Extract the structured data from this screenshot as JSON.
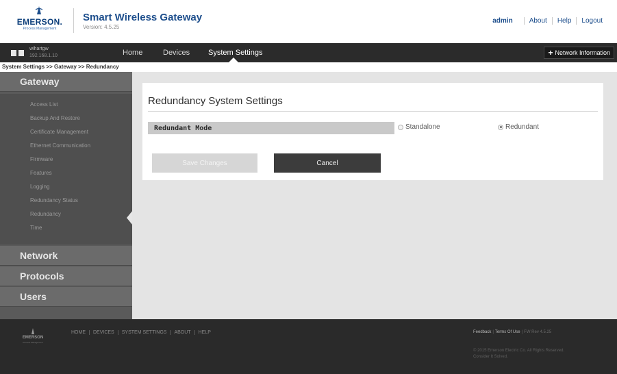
{
  "colors": {
    "brand_blue": "#1d4e8c",
    "nav_bg": "#2b2b2b",
    "sidebar_bg": "#4f4f4f",
    "sidebar_head_bg": "#6b6b6b",
    "main_bg": "#e4e4e4",
    "footer_bg": "#2a2a2a",
    "cancel_bg": "#3c3c3c",
    "save_disabled_bg": "#d6d6d6"
  },
  "header": {
    "logo_text": "EMERSON.",
    "logo_subtext": "Process Management",
    "app_title": "Smart Wireless Gateway",
    "version": "Version: 4.5.25",
    "user": "admin",
    "links": [
      "About",
      "Help",
      "Logout"
    ]
  },
  "navbar": {
    "gateway_name": "wihartgw",
    "gateway_ip": "192.168.1.10",
    "items": [
      "Home",
      "Devices",
      "System Settings"
    ],
    "active_item": "System Settings",
    "network_info_label": "Network Information",
    "network_info_icon": "plus-icon"
  },
  "breadcrumb": "System Settings >> Gateway >> Redundancy",
  "sidebar": {
    "sections": [
      "Gateway",
      "Network",
      "Protocols",
      "Users"
    ],
    "gateway_items": [
      "Access List",
      "Backup And Restore",
      "Certificate Management",
      "Ethernet Communication",
      "Firmware",
      "Features",
      "Logging",
      "Redundancy Status",
      "Redundancy",
      "Time"
    ],
    "active_item": "Redundancy"
  },
  "main": {
    "title": "Redundancy System Settings",
    "field_label": "Redundant Mode",
    "options": [
      {
        "label": "Standalone",
        "selected": false
      },
      {
        "label": "Redundant",
        "selected": true
      }
    ],
    "save_label": "Save Changes",
    "cancel_label": "Cancel"
  },
  "footer": {
    "logo_text": "EMERSON",
    "logo_subtext": "Process Management",
    "links": [
      "HOME",
      "DEVICES",
      "SYSTEM SETTINGS",
      "ABOUT",
      "HELP"
    ],
    "feedback": "Feedback",
    "terms": "Terms Of Use",
    "rev": "FW Rev 4.5.25",
    "copyright_1": "© 2015 Emerson Electric Co. All Rights Reserved.",
    "copyright_2": "Consider It Solved."
  }
}
